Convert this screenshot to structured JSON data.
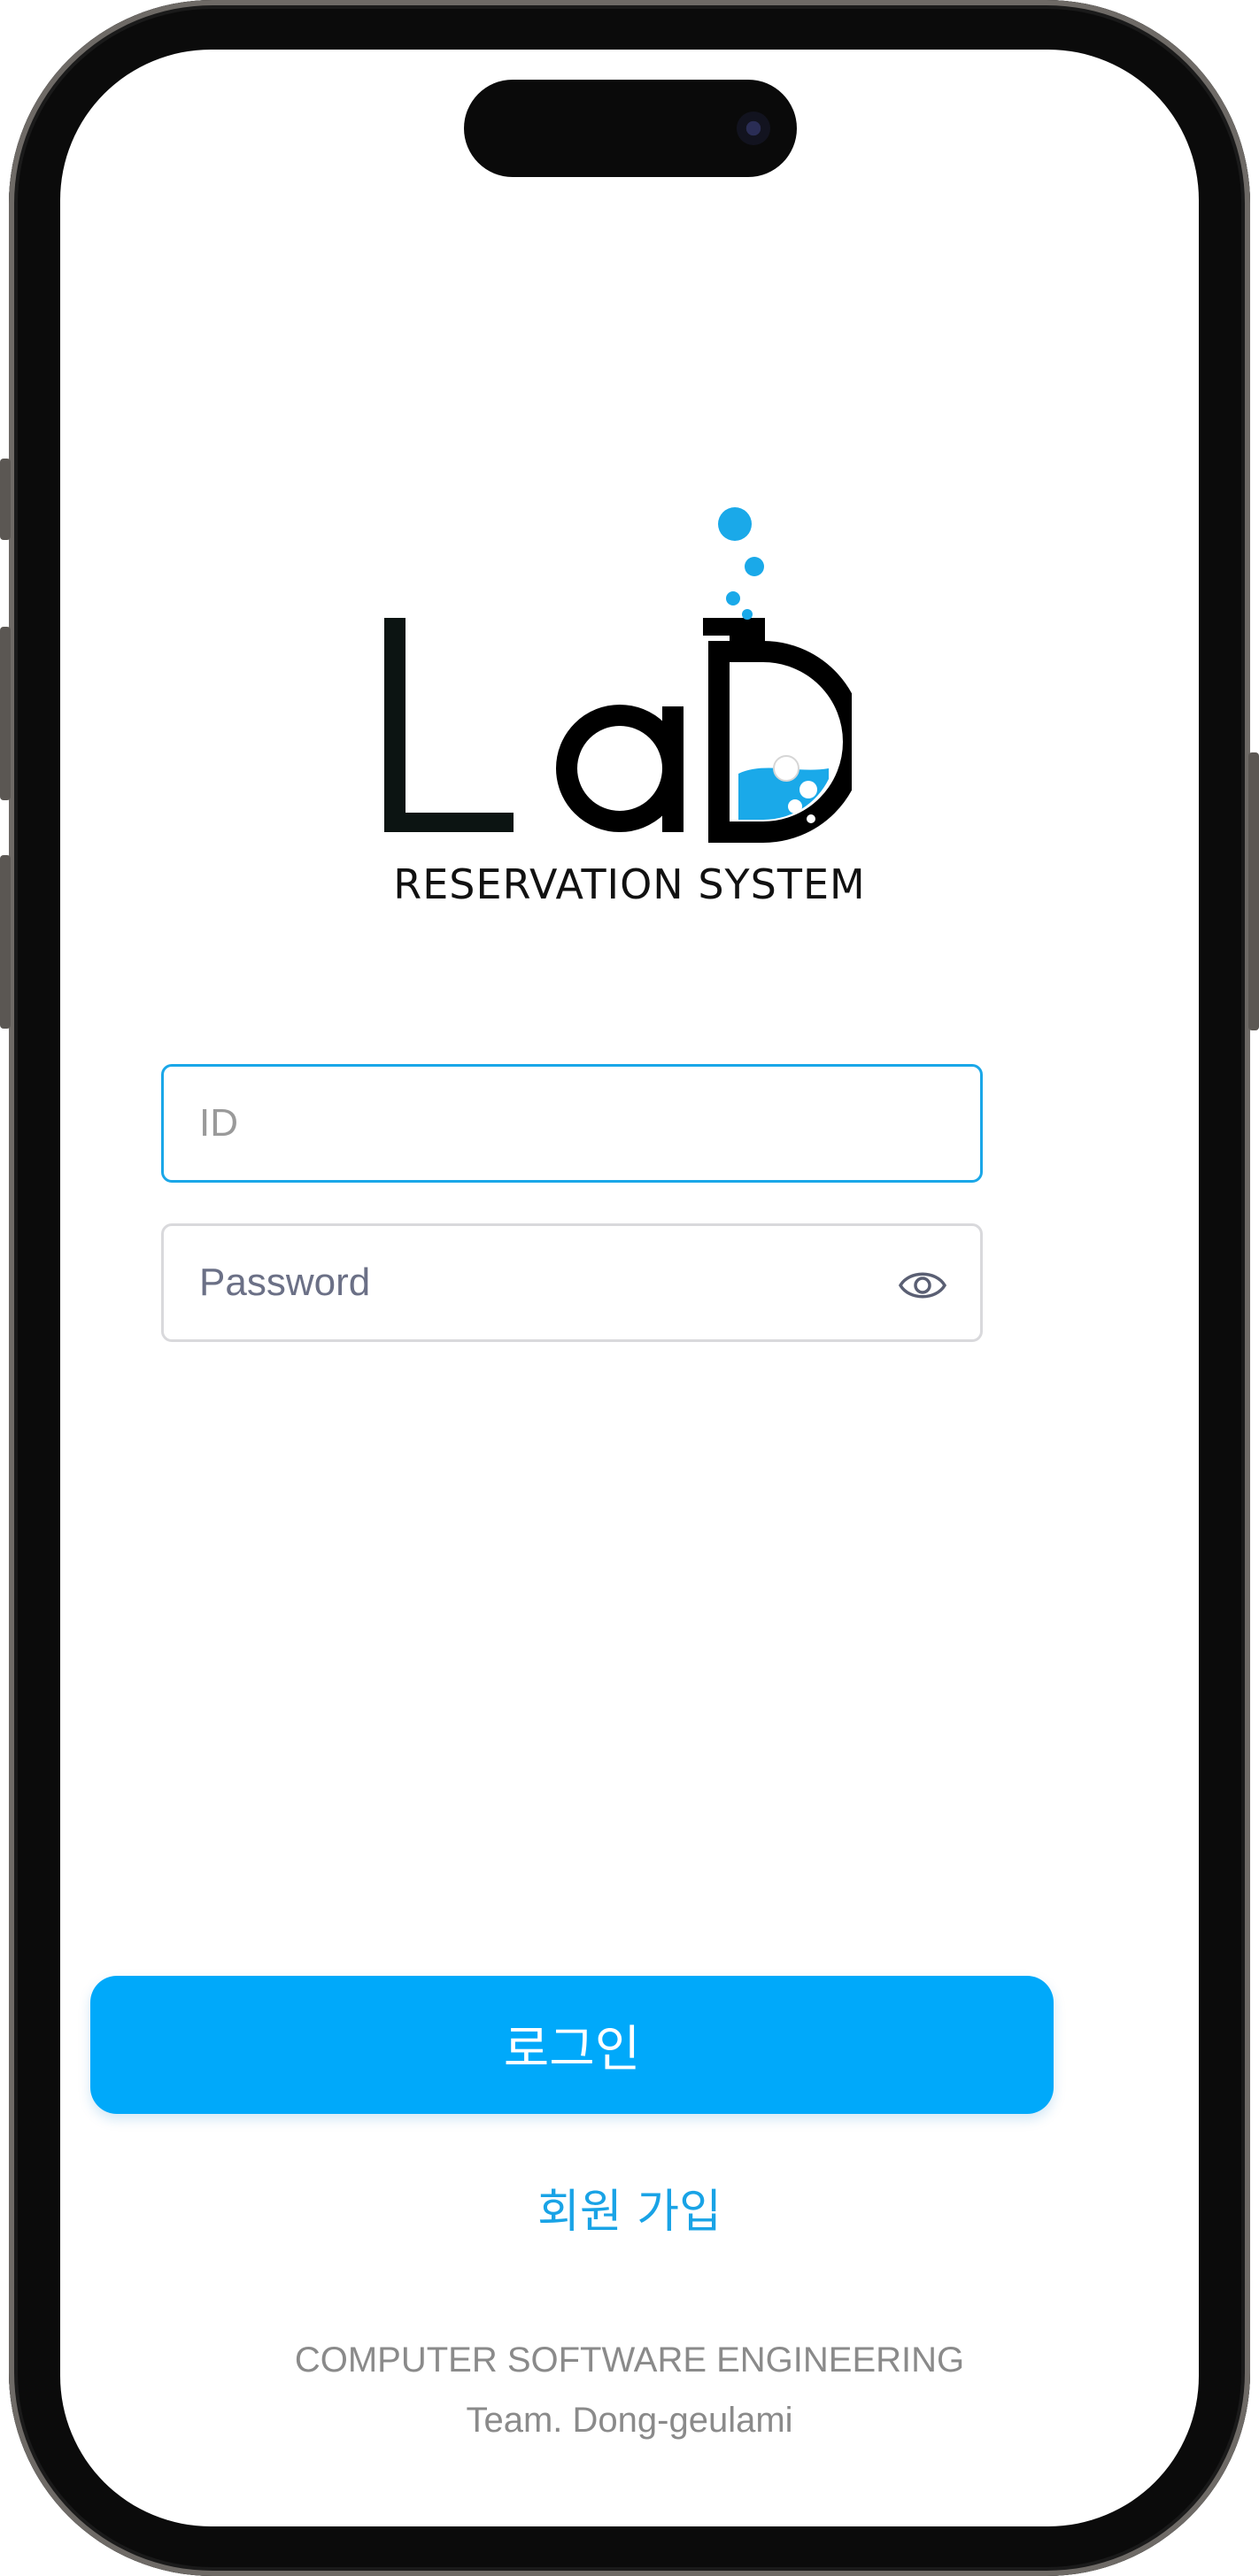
{
  "logo": {
    "wordmark": "Lab",
    "tagline": "RESERVATION SYSTEM",
    "accent_color": "#00aaee"
  },
  "form": {
    "id_placeholder": "ID",
    "password_placeholder": "Password",
    "eye_icon": "eye-icon"
  },
  "actions": {
    "login_label": "로그인",
    "signup_label": "회원 가입",
    "primary_color": "#00a9fa"
  },
  "footer": {
    "line1": "COMPUTER SOFTWARE ENGINEERING",
    "line2": "Team. Dong-geulami"
  }
}
